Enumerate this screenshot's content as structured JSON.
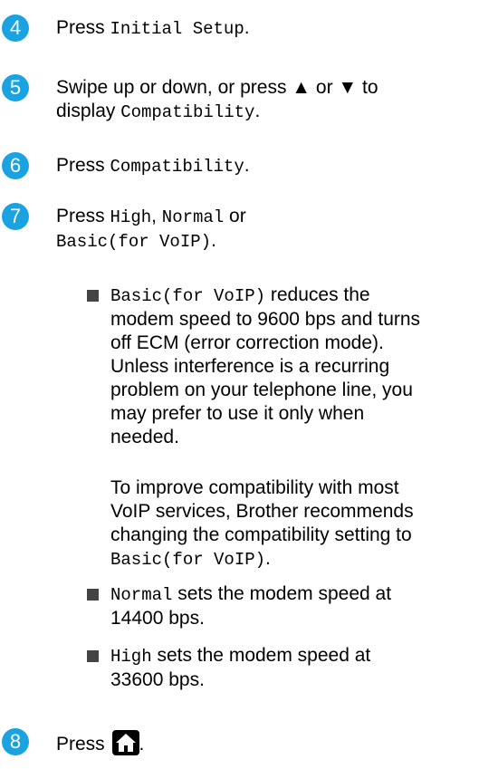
{
  "colors": {
    "step_badge": "#1aa3e0"
  },
  "steps": [
    {
      "number": "4",
      "text_before": "Press ",
      "code": "Initial Setup",
      "text_after": "."
    },
    {
      "number": "5",
      "line1": "Swipe up or down, or press ▲ or ▼ to",
      "line2_text": "display ",
      "line2_code": "Compatibility",
      "line2_after": "."
    },
    {
      "number": "6",
      "text_before": "Press ",
      "code": "Compatibility",
      "text_after": "."
    },
    {
      "number": "7",
      "text_before": "Press ",
      "code_high": "High",
      "sep1": ", ",
      "code_normal": "Normal",
      "sep2": " or",
      "code_basic": "Basic(for VoIP)",
      "text_after": "."
    },
    {
      "number": "8",
      "text_before": "Press ",
      "icon": "home-icon",
      "text_after": "."
    }
  ],
  "bullets": [
    {
      "code": "Basic(for VoIP)",
      "lines": [
        " reduces the",
        "modem speed to 9600 bps and turns",
        "off ECM (error correction mode).",
        "Unless interference is a recurring",
        "problem on your telephone line, you",
        "may prefer to use it only when",
        "needed."
      ],
      "note_lines": [
        "To improve compatibility with most",
        "VoIP services, Brother recommends",
        "changing the compatibility setting to"
      ],
      "note_code": "Basic(for VoIP)",
      "note_after": "."
    },
    {
      "code": "Normal",
      "line1": " sets the modem speed at",
      "line2": "14400 bps."
    },
    {
      "code": "High",
      "line1": " sets the modem speed at",
      "line2": "33600 bps."
    }
  ]
}
